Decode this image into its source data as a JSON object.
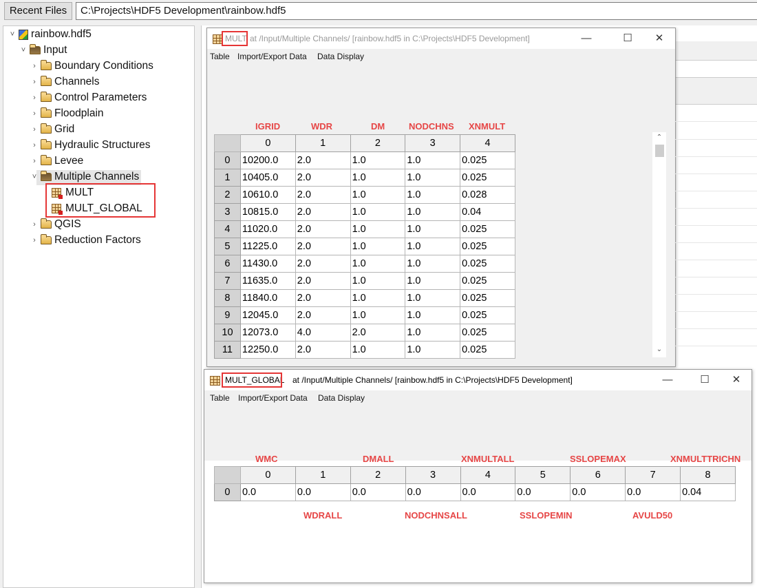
{
  "topbar": {
    "recent_files_label": "Recent Files",
    "path_value": "C:\\Projects\\HDF5 Development\\rainbow.hdf5"
  },
  "tree": {
    "root": "rainbow.hdf5",
    "input": "Input",
    "items": [
      "Boundary Conditions",
      "Channels",
      "Control Parameters",
      "Floodplain",
      "Grid",
      "Hydraulic Structures",
      "Levee",
      "Multiple Channels"
    ],
    "datasets": [
      "MULT",
      "MULT_GLOBAL"
    ],
    "after": [
      "QGIS",
      "Reduction Factors"
    ]
  },
  "window1": {
    "name": "MULT",
    "title_rest": "at  /Input/Multiple Channels/  [rainbow.hdf5  in  C:\\Projects\\HDF5 Development]",
    "menu": [
      "Table",
      "Import/Export Data",
      "Data Display"
    ],
    "col_labels": [
      "IGRID",
      "WDR",
      "DM",
      "NODCHNS",
      "XNMULT"
    ],
    "headers": [
      "0",
      "1",
      "2",
      "3",
      "4"
    ],
    "rows": [
      [
        "0",
        "10200.0",
        "2.0",
        "1.0",
        "1.0",
        "0.025"
      ],
      [
        "1",
        "10405.0",
        "2.0",
        "1.0",
        "1.0",
        "0.025"
      ],
      [
        "2",
        "10610.0",
        "2.0",
        "1.0",
        "1.0",
        "0.028"
      ],
      [
        "3",
        "10815.0",
        "2.0",
        "1.0",
        "1.0",
        "0.04"
      ],
      [
        "4",
        "11020.0",
        "2.0",
        "1.0",
        "1.0",
        "0.025"
      ],
      [
        "5",
        "11225.0",
        "2.0",
        "1.0",
        "1.0",
        "0.025"
      ],
      [
        "6",
        "11430.0",
        "2.0",
        "1.0",
        "1.0",
        "0.025"
      ],
      [
        "7",
        "11635.0",
        "2.0",
        "1.0",
        "1.0",
        "0.025"
      ],
      [
        "8",
        "11840.0",
        "2.0",
        "1.0",
        "1.0",
        "0.025"
      ],
      [
        "9",
        "12045.0",
        "2.0",
        "1.0",
        "1.0",
        "0.025"
      ],
      [
        "10",
        "12073.0",
        "4.0",
        "2.0",
        "1.0",
        "0.025"
      ],
      [
        "11",
        "12250.0",
        "2.0",
        "1.0",
        "1.0",
        "0.025"
      ]
    ]
  },
  "window2": {
    "name": "MULT_GLOBAL",
    "title_rest": "at  /Input/Multiple Channels/  [rainbow.hdf5  in  C:\\Projects\\HDF5 Development]",
    "menu": [
      "Table",
      "Import/Export Data",
      "Data Display"
    ],
    "top_labels": [
      "WMC",
      "DMALL",
      "XNMULTALL",
      "SSLOPEMAX",
      "XNMULTTRICHN"
    ],
    "bottom_labels": [
      "WDRALL",
      "NODCHNSALL",
      "SSLOPEMIN",
      "AVULD50"
    ],
    "headers": [
      "0",
      "1",
      "2",
      "3",
      "4",
      "5",
      "6",
      "7",
      "8"
    ],
    "row": [
      "0",
      "0.0",
      "0.0",
      "0.0",
      "0.0",
      "0.0",
      "0.0",
      "0.0",
      "0.0",
      "0.04"
    ]
  },
  "icons": {
    "minimize": "minimize-icon",
    "maximize": "maximize-icon",
    "close": "close-icon",
    "scroll_up": "scroll-up-icon",
    "scroll_down": "scroll-down-icon"
  },
  "colors": {
    "annotation_red": "#e53535",
    "column_label_red": "#e64646"
  }
}
